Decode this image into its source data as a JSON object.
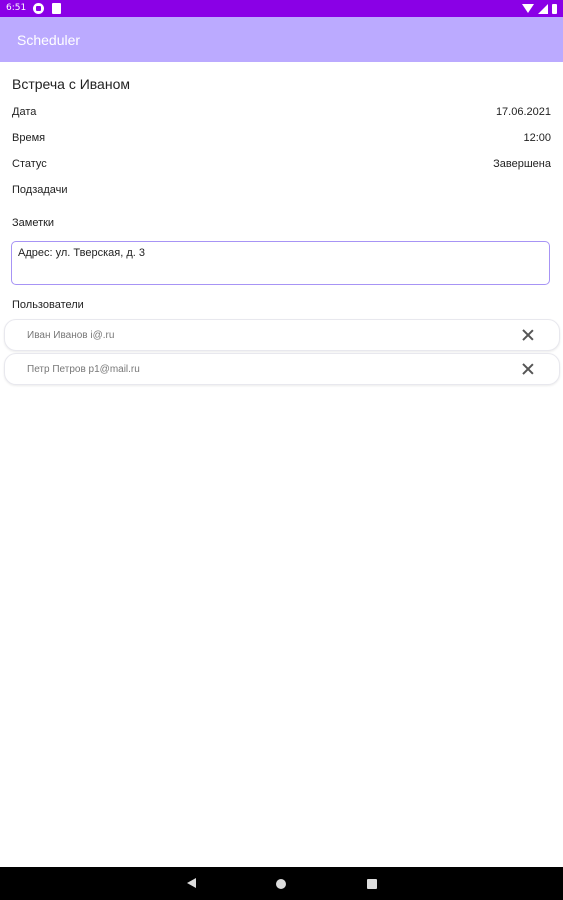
{
  "status_bar": {
    "time": "6:51",
    "icons": [
      "notification-app-icon",
      "sd-card-icon",
      "wifi-icon",
      "signal-icon",
      "battery-icon"
    ],
    "background": "#8a00e6"
  },
  "app_bar": {
    "title": "Scheduler",
    "background": "#bbaaff"
  },
  "task": {
    "title": "Встреча с Иваном",
    "fields": [
      {
        "label": "Дата",
        "value": "17.06.2021"
      },
      {
        "label": "Время",
        "value": "12:00"
      },
      {
        "label": "Статус",
        "value": "Завершена"
      }
    ],
    "subtasks_label": "Подзадачи",
    "notes_label": "Заметки",
    "notes_value": "Адрес: ул. Тверская, д. 3",
    "users_label": "Пользователи",
    "users": [
      {
        "text": "Иван Иванов i@.ru"
      },
      {
        "text": "Петр Петров p1@mail.ru"
      }
    ]
  },
  "nav_bar": {
    "buttons": [
      "back-icon",
      "home-icon",
      "recents-icon"
    ]
  },
  "colors": {
    "accent": "#a794f5",
    "text": "#222222",
    "secondary_text": "#777777"
  }
}
